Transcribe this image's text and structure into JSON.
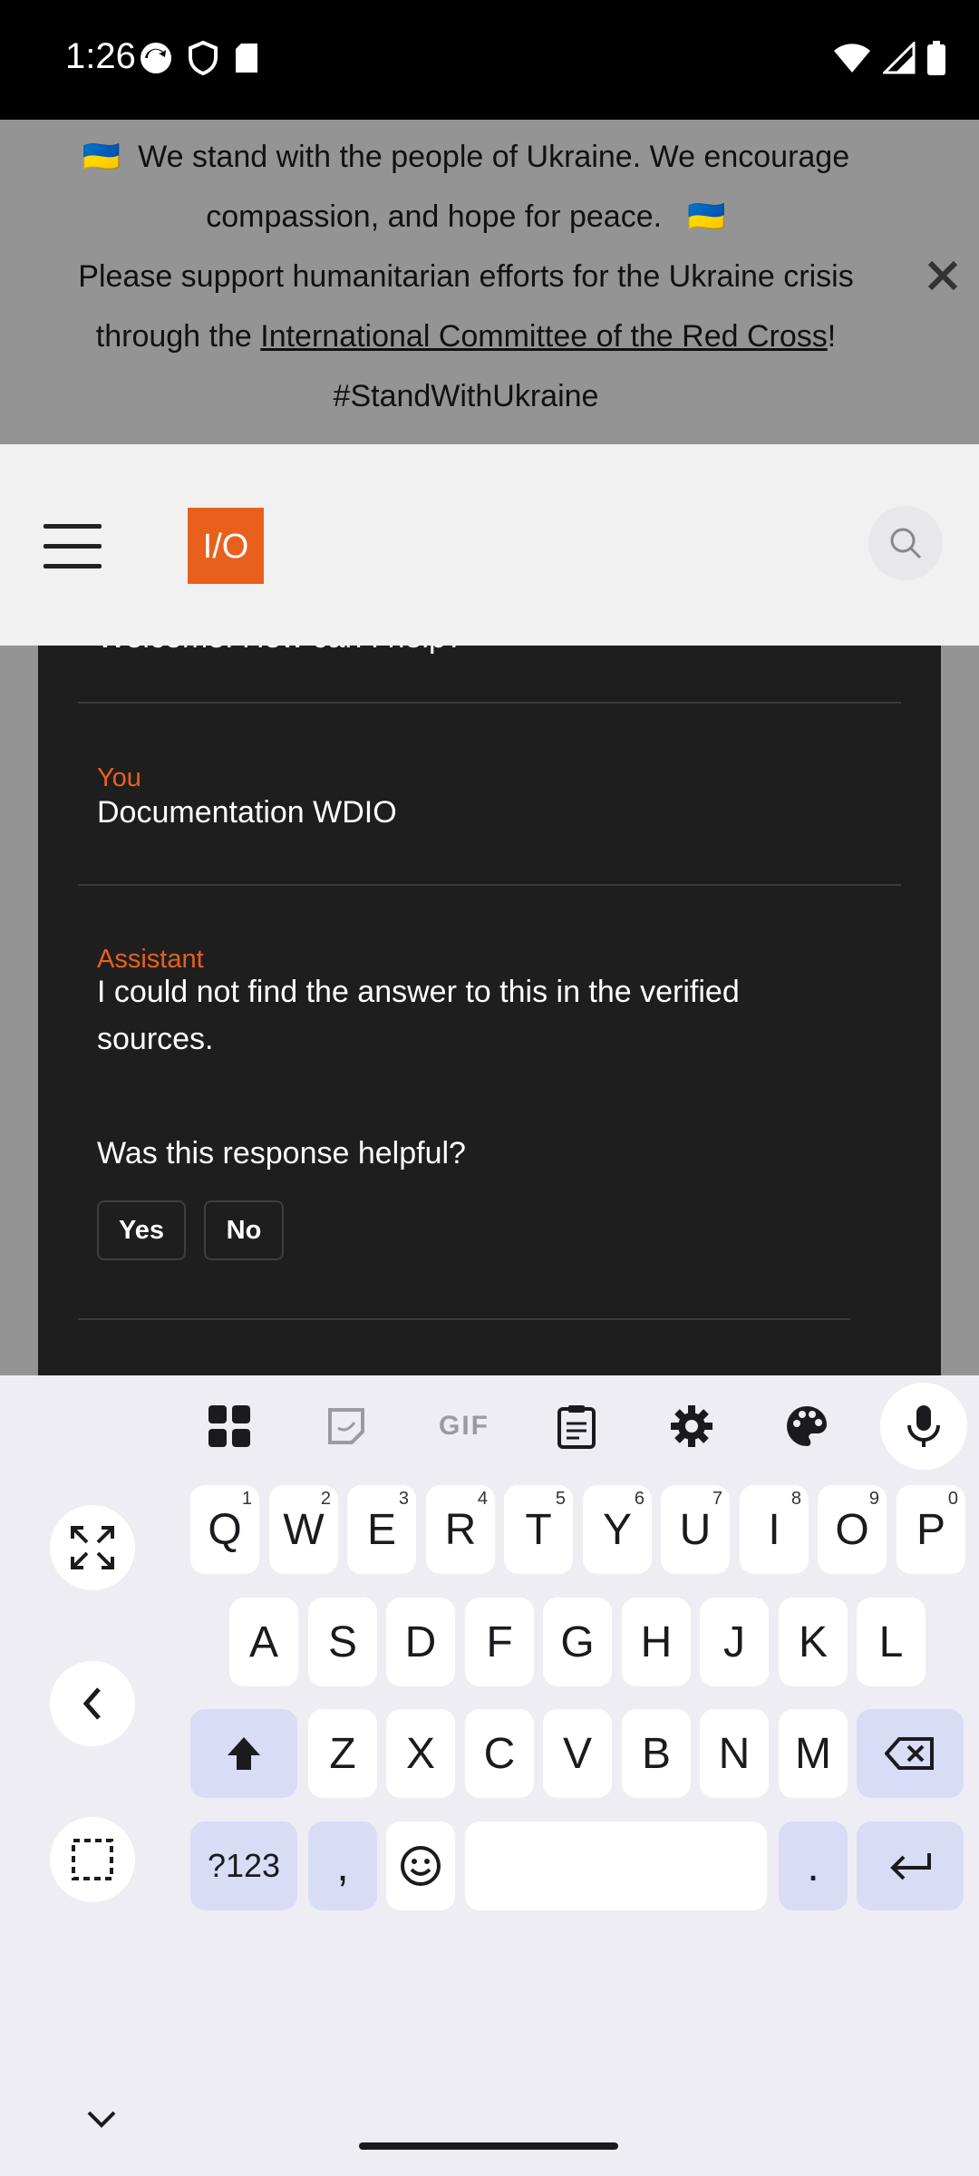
{
  "status_bar": {
    "time": "1:26"
  },
  "banner": {
    "flag_emoji": "🇺🇦",
    "line1": "We stand with the people of Ukraine. We encourage",
    "line2": "compassion, and hope for peace.",
    "line3": "Please support humanitarian efforts for the Ukraine crisis",
    "line4_prefix": "through the ",
    "link_text": "International Committee of the Red Cross",
    "line4_suffix": "!",
    "hashtag": "#StandWithUkraine"
  },
  "header": {
    "logo_text": "I/O"
  },
  "chat": {
    "cut_off_text": "Welcome! How can I help?",
    "messages": [
      {
        "role": "You",
        "text": "Documentation WDIO"
      },
      {
        "role": "Assistant",
        "text": "I could not find the answer to this in the verified sources."
      }
    ],
    "feedback_question": "Was this response helpful?",
    "yes_label": "Yes",
    "no_label": "No"
  },
  "keyboard": {
    "row1": [
      {
        "key": "Q",
        "hint": "1"
      },
      {
        "key": "W",
        "hint": "2"
      },
      {
        "key": "E",
        "hint": "3"
      },
      {
        "key": "R",
        "hint": "4"
      },
      {
        "key": "T",
        "hint": "5"
      },
      {
        "key": "Y",
        "hint": "6"
      },
      {
        "key": "U",
        "hint": "7"
      },
      {
        "key": "I",
        "hint": "8"
      },
      {
        "key": "O",
        "hint": "9"
      },
      {
        "key": "P",
        "hint": "0"
      }
    ],
    "row2": [
      "A",
      "S",
      "D",
      "F",
      "G",
      "H",
      "J",
      "K",
      "L"
    ],
    "row3": [
      "Z",
      "X",
      "C",
      "V",
      "B",
      "N",
      "M"
    ],
    "symbols_label": "?123",
    "comma": ",",
    "period": ".",
    "toolbar_gif": "GIF"
  },
  "colors": {
    "accent": "#e8601c",
    "chat_bg": "#1e1e1f",
    "banner_bg": "#949494"
  }
}
